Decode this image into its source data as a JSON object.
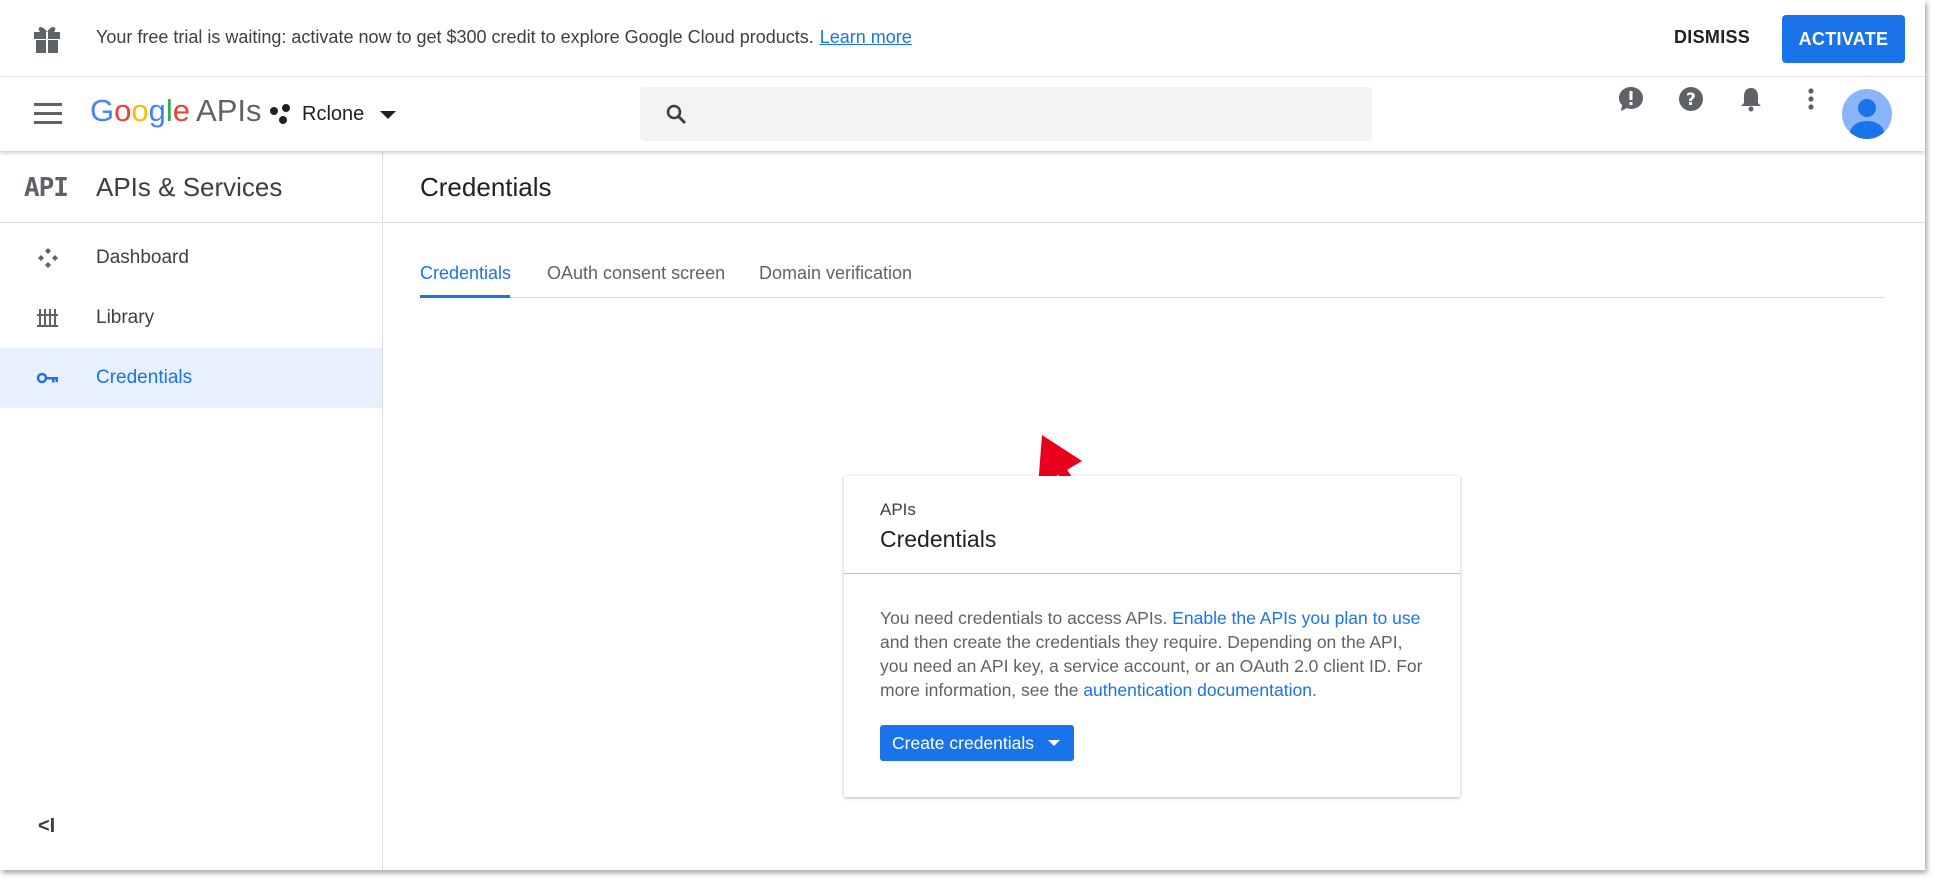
{
  "banner": {
    "message": "Your free trial is waiting: activate now to get $300 credit to explore Google Cloud products.",
    "learn_more": "Learn more",
    "dismiss": "DISMISS",
    "activate": "ACTIVATE"
  },
  "header": {
    "logo_google": [
      "G",
      "o",
      "o",
      "g",
      "l",
      "e"
    ],
    "logo_suffix": "APIs",
    "project_name": "Rclone",
    "search_placeholder": ""
  },
  "sidebar": {
    "section_logo": "API",
    "section_title": "APIs & Services",
    "items": [
      {
        "label": "Dashboard",
        "icon": "dashboard-icon",
        "active": false
      },
      {
        "label": "Library",
        "icon": "library-icon",
        "active": false
      },
      {
        "label": "Credentials",
        "icon": "key-icon",
        "active": true
      }
    ],
    "collapse_glyph": "<I"
  },
  "main": {
    "title": "Credentials",
    "tabs": [
      {
        "label": "Credentials",
        "active": true
      },
      {
        "label": "OAuth consent screen",
        "active": false
      },
      {
        "label": "Domain verification",
        "active": false
      }
    ],
    "card": {
      "subtitle": "APIs",
      "title": "Credentials",
      "text_1": "You need credentials to access APIs.",
      "link_1": "Enable the APIs you plan to use",
      "text_2": "and then create the credentials they require. Depending on the API, you need an API key, a service account, or an OAuth 2.0 client ID. For more information, see the",
      "link_2": "authentication documentation",
      "text_3": ".",
      "button": "Create credentials"
    }
  },
  "colors": {
    "accent": "#1a73e8",
    "annotation_arrow": "#e8001c",
    "active_nav_bg": "#e8f0fe"
  }
}
